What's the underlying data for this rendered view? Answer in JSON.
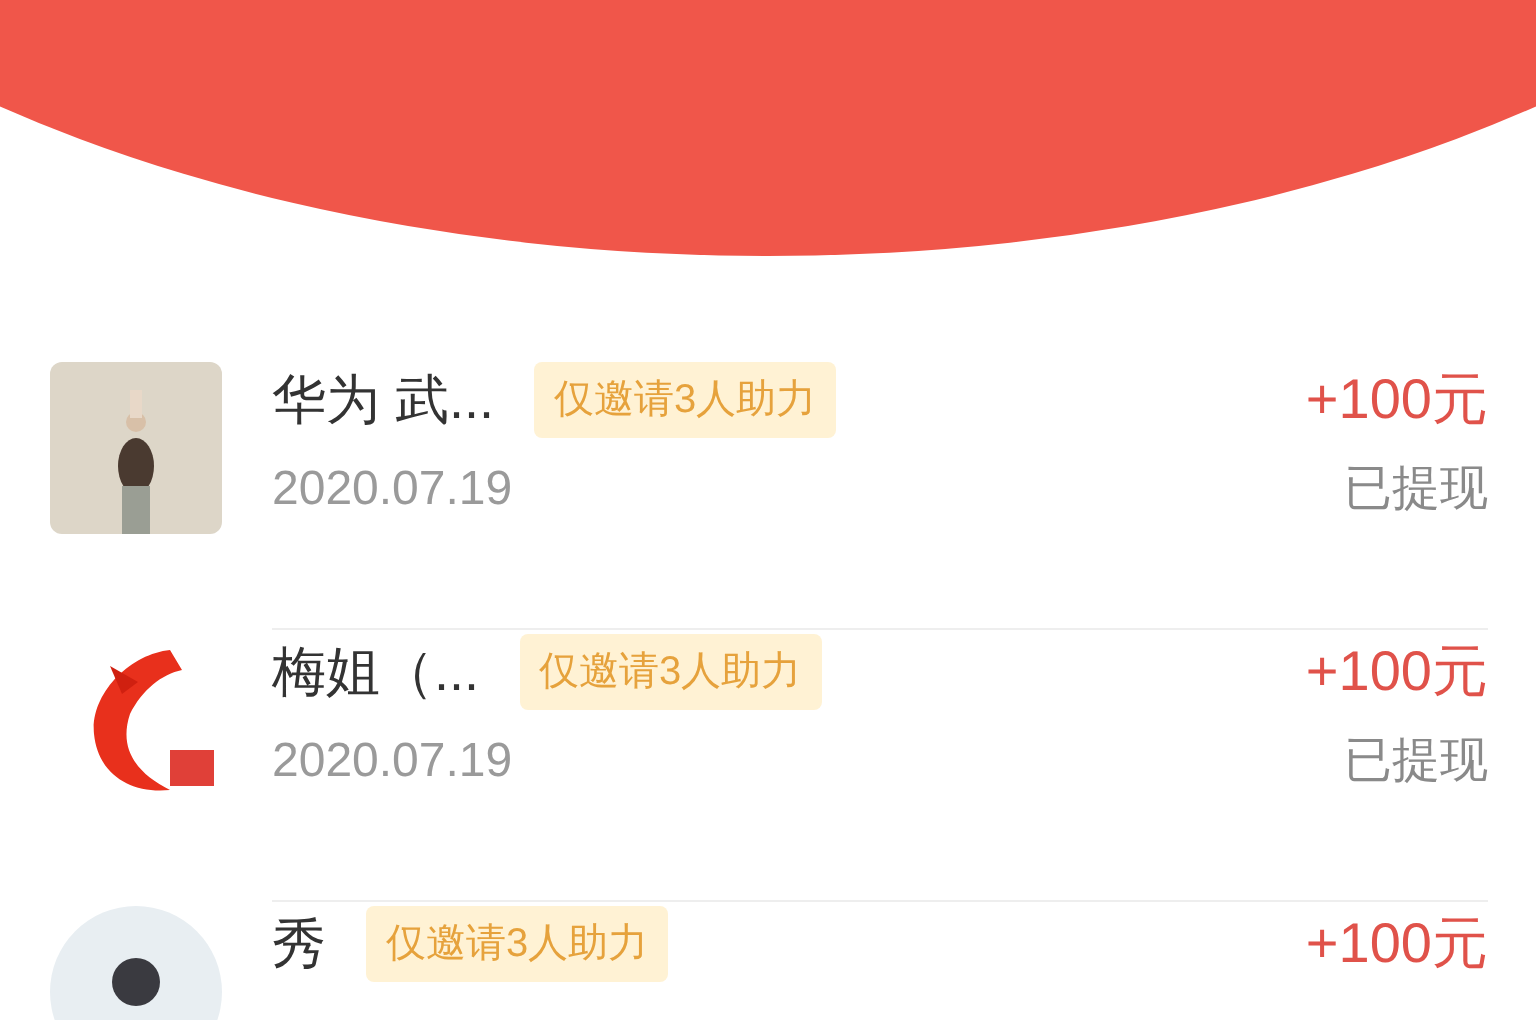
{
  "records": [
    {
      "avatar": {
        "kind": "picture",
        "round": false
      },
      "name": "华为 武...",
      "badge": "仅邀请3人助力",
      "amount": "+100元",
      "date": "2020.07.19",
      "status": "已提现"
    },
    {
      "avatar": {
        "kind": "picture",
        "round": false
      },
      "name": "梅姐（...",
      "badge": "仅邀请3人助力",
      "amount": "+100元",
      "date": "2020.07.19",
      "status": "已提现"
    },
    {
      "avatar": {
        "kind": "picture",
        "round": true
      },
      "name": "秀",
      "badge": "仅邀请3人助力",
      "amount": "+100元"
    }
  ]
}
